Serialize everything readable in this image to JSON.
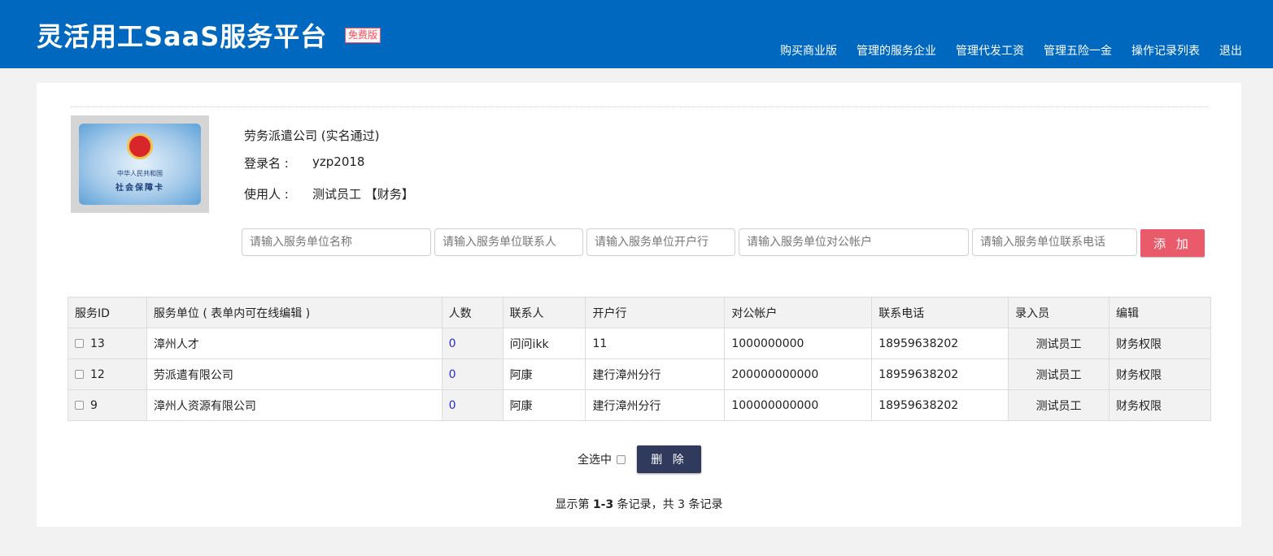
{
  "header": {
    "title": "灵活用工SaaS服务平台",
    "badge": "免费版",
    "nav": [
      "购买商业版",
      "管理的服务企业",
      "管理代发工资",
      "管理五险一金",
      "操作记录列表",
      "退出"
    ]
  },
  "colors": {
    "header_bg": "#0068bf",
    "add_button": "#e95a6b",
    "delete_button": "#2f3a5c"
  },
  "profile": {
    "card_line1": "中华人民共和国",
    "card_line2": "社会保障卡",
    "company": "劳务派遣公司 (实名通过)",
    "login_label": "登录名 :",
    "login_value": "yzp2018",
    "user_label": "使用人 :",
    "user_value": "测试员工 【财务】"
  },
  "form": {
    "name_placeholder": "请输入服务单位名称",
    "contact_placeholder": "请输入服务单位联系人",
    "bank_placeholder": "请输入服务单位开户行",
    "account_placeholder": "请输入服务单位对公帐户",
    "phone_placeholder": "请输入服务单位联系电话",
    "add_label": "添 加"
  },
  "table": {
    "headers": [
      "服务ID",
      "服务单位 ( 表单内可在线编辑 )",
      "人数",
      "联系人",
      "开户行",
      "对公帐户",
      "联系电话",
      "录入员",
      "编辑"
    ],
    "rows": [
      {
        "id": "13",
        "unit": "漳州人才",
        "count": "0",
        "contact": "问问ikk",
        "bank": "11",
        "account": "1000000000",
        "phone": "18959638202",
        "operator": "测试员工",
        "edit": "财务权限"
      },
      {
        "id": "12",
        "unit": "劳派遣有限公司",
        "count": "0",
        "contact": "阿康",
        "bank": "建行漳州分行",
        "account": "200000000000",
        "phone": "18959638202",
        "operator": "测试员工",
        "edit": "财务权限"
      },
      {
        "id": "9",
        "unit": "漳州人资源有限公司",
        "count": "0",
        "contact": "阿康",
        "bank": "建行漳州分行",
        "account": "100000000000",
        "phone": "18959638202",
        "operator": "测试员工",
        "edit": "财务权限"
      }
    ]
  },
  "actions": {
    "select_all_label": "全选中",
    "delete_label": "删 除"
  },
  "pager": {
    "prefix": "显示第 ",
    "range": "1-3",
    "middle": " 条记录，共 ",
    "total": "3",
    "suffix": " 条记录"
  }
}
